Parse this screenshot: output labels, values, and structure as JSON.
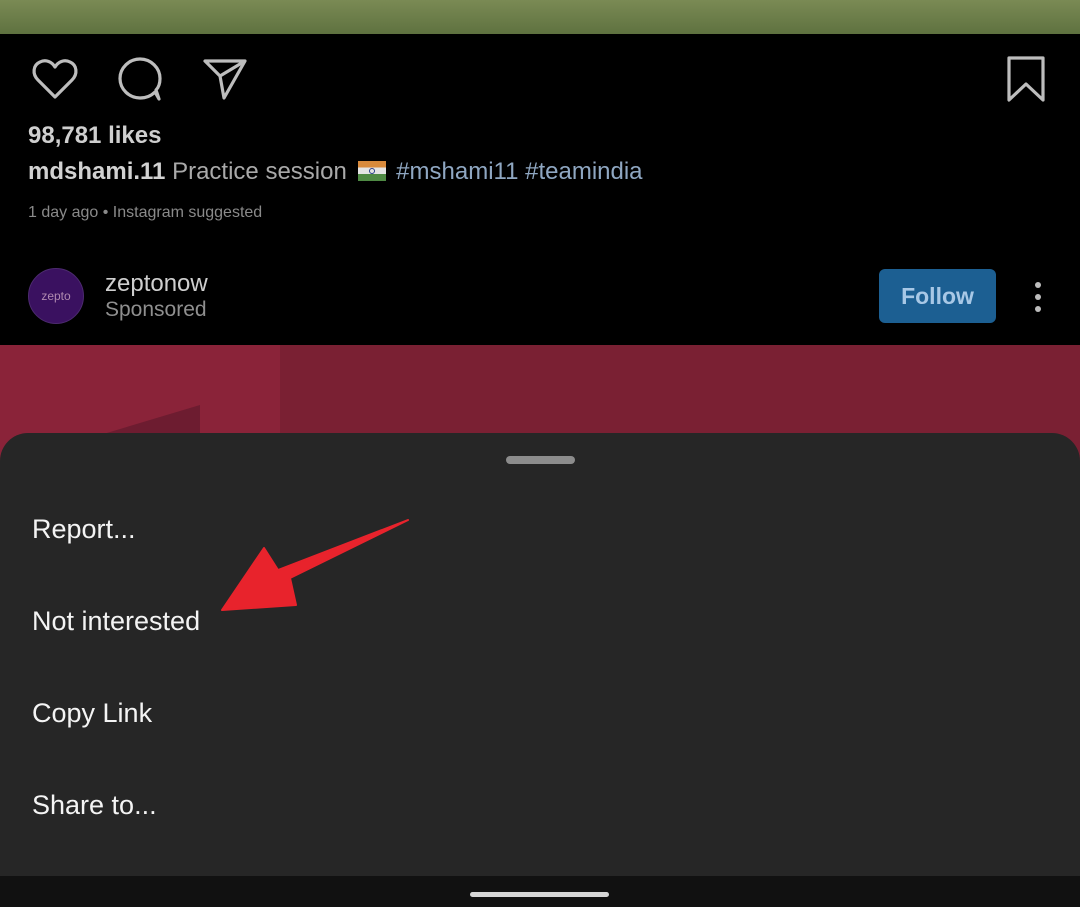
{
  "post": {
    "likes": "98,781 likes",
    "caption_user": "mdshami.11",
    "caption_text": "Practice session",
    "hashtags": "#mshami11 #teamindia",
    "meta": "1 day ago • Instagram suggested"
  },
  "sponsored": {
    "avatar_text": "zepto",
    "name": "zeptonow",
    "label": "Sponsored",
    "follow_label": "Follow"
  },
  "sheet": {
    "items": [
      {
        "label": "Report..."
      },
      {
        "label": "Not interested"
      },
      {
        "label": "Copy Link"
      },
      {
        "label": "Share to..."
      }
    ]
  },
  "colors": {
    "sheet_bg": "#262626",
    "follow_bg": "#1c5f92",
    "annotation": "#e8232c"
  },
  "icons": [
    "heart-icon",
    "comment-icon",
    "send-icon",
    "bookmark-icon",
    "more-vertical-icon",
    "india-flag-icon"
  ]
}
